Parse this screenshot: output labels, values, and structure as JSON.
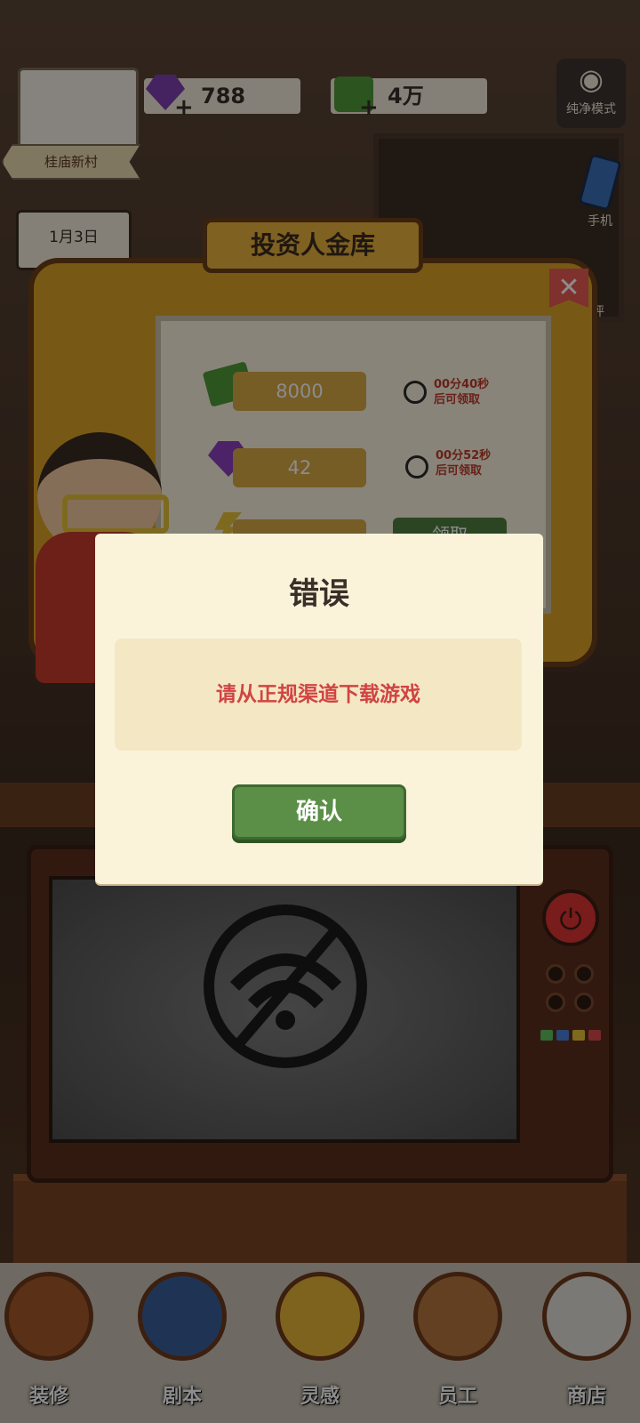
{
  "topbar": {
    "gems": "788",
    "cash": "4万",
    "pure_mode_label": "纯净模式",
    "phone_label": "手机",
    "review_label": "评",
    "village_label": "桂庙新村",
    "date_label": "1月3日"
  },
  "vault": {
    "title": "投资人金库",
    "rows": [
      {
        "icon": "cash-stack-icon",
        "value": "8000",
        "timer_line1": "00分40秒",
        "timer_line2": "后可领取"
      },
      {
        "icon": "gem-icon",
        "value": "42",
        "timer_line1": "00分52秒",
        "timer_line2": "后可领取"
      },
      {
        "icon": "lightning-icon",
        "value": "",
        "claim_label": "领取"
      }
    ]
  },
  "dialog": {
    "title": "错误",
    "message": "请从正规渠道下载游戏",
    "confirm_label": "确认"
  },
  "bottom_nav": [
    {
      "label": "装修",
      "icon": "decorate-icon"
    },
    {
      "label": "剧本",
      "icon": "script-book-icon"
    },
    {
      "label": "灵感",
      "icon": "inspiration-bulb-icon"
    },
    {
      "label": "员工",
      "icon": "staff-badge-icon"
    },
    {
      "label": "商店",
      "icon": "shop-icon"
    }
  ],
  "colors": {
    "dialog_bg": "#faf3da",
    "message_red": "#d04444",
    "confirm_green": "#5b8f47",
    "vault_gold": "#d9a227"
  }
}
